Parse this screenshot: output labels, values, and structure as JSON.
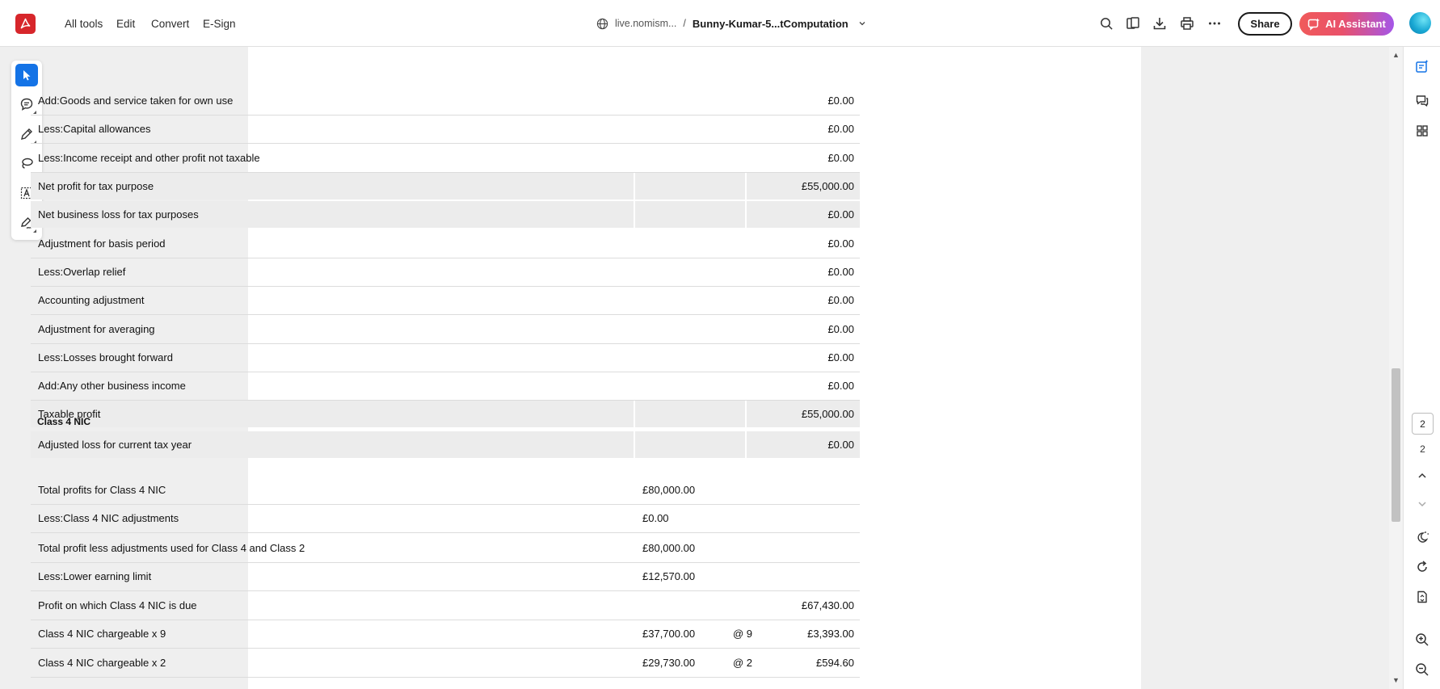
{
  "menu": {
    "all_tools": "All tools",
    "edit": "Edit",
    "convert": "Convert",
    "esign": "E-Sign"
  },
  "breadcrumb": {
    "site": "live.nomism...",
    "separator": "/",
    "document": "Bunny-Kumar-5...tComputation"
  },
  "actions": {
    "share": "Share",
    "ai_assistant": "AI Assistant"
  },
  "pagination": {
    "current": "2",
    "total": "2"
  },
  "colors": {
    "accent": "#1473e6",
    "logo": "#d7262b"
  },
  "table_rows": [
    {
      "label": "Add:Goods and service taken for own use",
      "amount": "£0.00",
      "shaded": false
    },
    {
      "label": "Less:Capital allowances",
      "amount": "£0.00",
      "shaded": false
    },
    {
      "label": "Less:Income receipt and other profit not taxable",
      "amount": "£0.00",
      "shaded": false
    },
    {
      "label": "Net profit for tax purpose",
      "amount": "£55,000.00",
      "shaded": true
    },
    {
      "label": "Net business loss for tax purposes",
      "amount": "£0.00",
      "shaded": true
    },
    {
      "label": "Adjustment for basis period",
      "amount": "£0.00",
      "shaded": false
    },
    {
      "label": "Less:Overlap relief",
      "amount": "£0.00",
      "shaded": false
    },
    {
      "label": "Accounting adjustment",
      "amount": "£0.00",
      "shaded": false
    },
    {
      "label": "Adjustment for averaging",
      "amount": "£0.00",
      "shaded": false
    },
    {
      "label": "Less:Losses brought forward",
      "amount": "£0.00",
      "shaded": false
    },
    {
      "label": "Add:Any other business income",
      "amount": "£0.00",
      "shaded": false
    },
    {
      "label": "Taxable profit",
      "amount": "£55,000.00",
      "shaded": true
    },
    {
      "label": "Adjusted loss for current tax year",
      "amount": "£0.00",
      "shaded": true
    }
  ],
  "nic_section_title": "Class 4 NIC",
  "nic_rows": [
    {
      "label": "Total profits for Class 4 NIC",
      "value": "£80,000.00",
      "rate": "",
      "amount": ""
    },
    {
      "label": "Less:Class 4 NIC adjustments",
      "value": "£0.00",
      "rate": "",
      "amount": ""
    },
    {
      "label": "Total profit less adjustments used for Class 4 and Class 2",
      "value": "£80,000.00",
      "rate": "",
      "amount": ""
    },
    {
      "label": "Less:Lower earning limit",
      "value": "£12,570.00",
      "rate": "",
      "amount": ""
    },
    {
      "label": "Profit on which Class 4 NIC is due",
      "value": "",
      "rate": "",
      "amount": "£67,430.00"
    },
    {
      "label": "Class 4 NIC chargeable x 9",
      "value": "£37,700.00",
      "rate": "@ 9",
      "amount": "£3,393.00"
    },
    {
      "label": "Class 4 NIC chargeable x 2",
      "value": "£29,730.00",
      "rate": "@ 2",
      "amount": "£594.60"
    }
  ]
}
